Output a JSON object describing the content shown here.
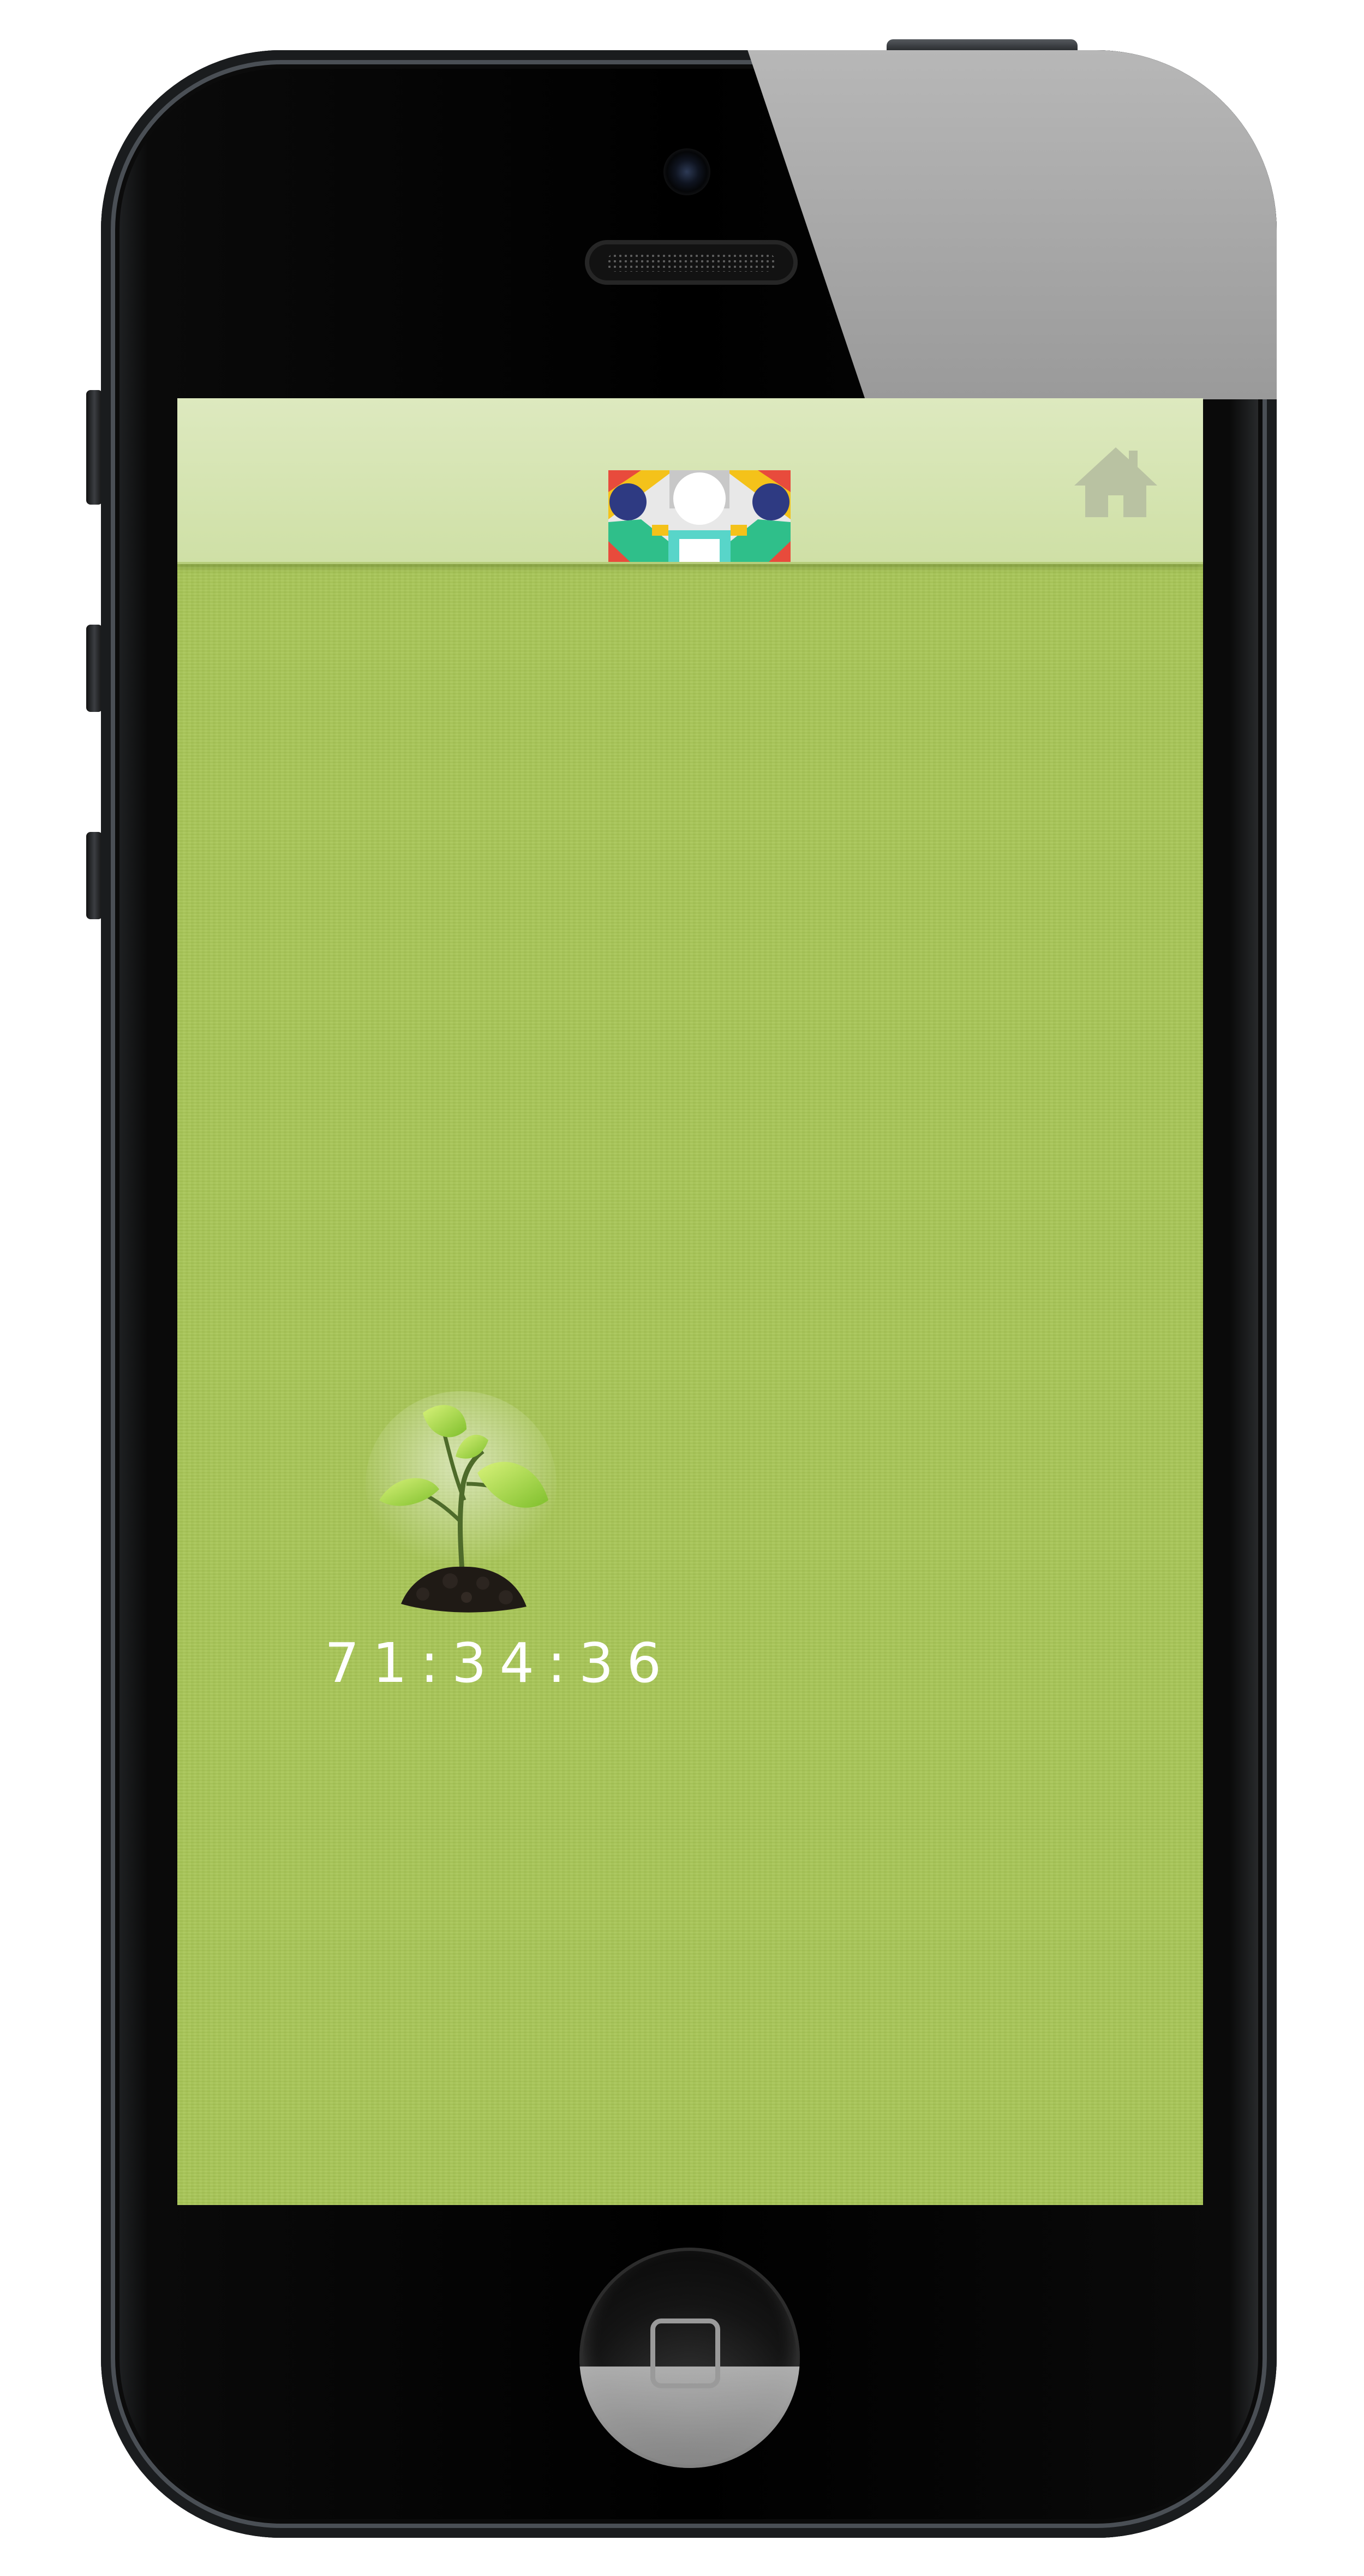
{
  "device": {
    "frame_color": "#000000",
    "screen_background": "#a8c657"
  },
  "header": {
    "background": "#d8e7b4",
    "logo_icon": "colorful-face-logo-icon",
    "home_icon": "home-icon",
    "home_icon_color": "#b9c2a2"
  },
  "main": {
    "plant_icon": "sprout-icon",
    "timer_text": "71:34:36"
  },
  "hardware": {
    "home_button_icon": "home-button-square-icon"
  }
}
